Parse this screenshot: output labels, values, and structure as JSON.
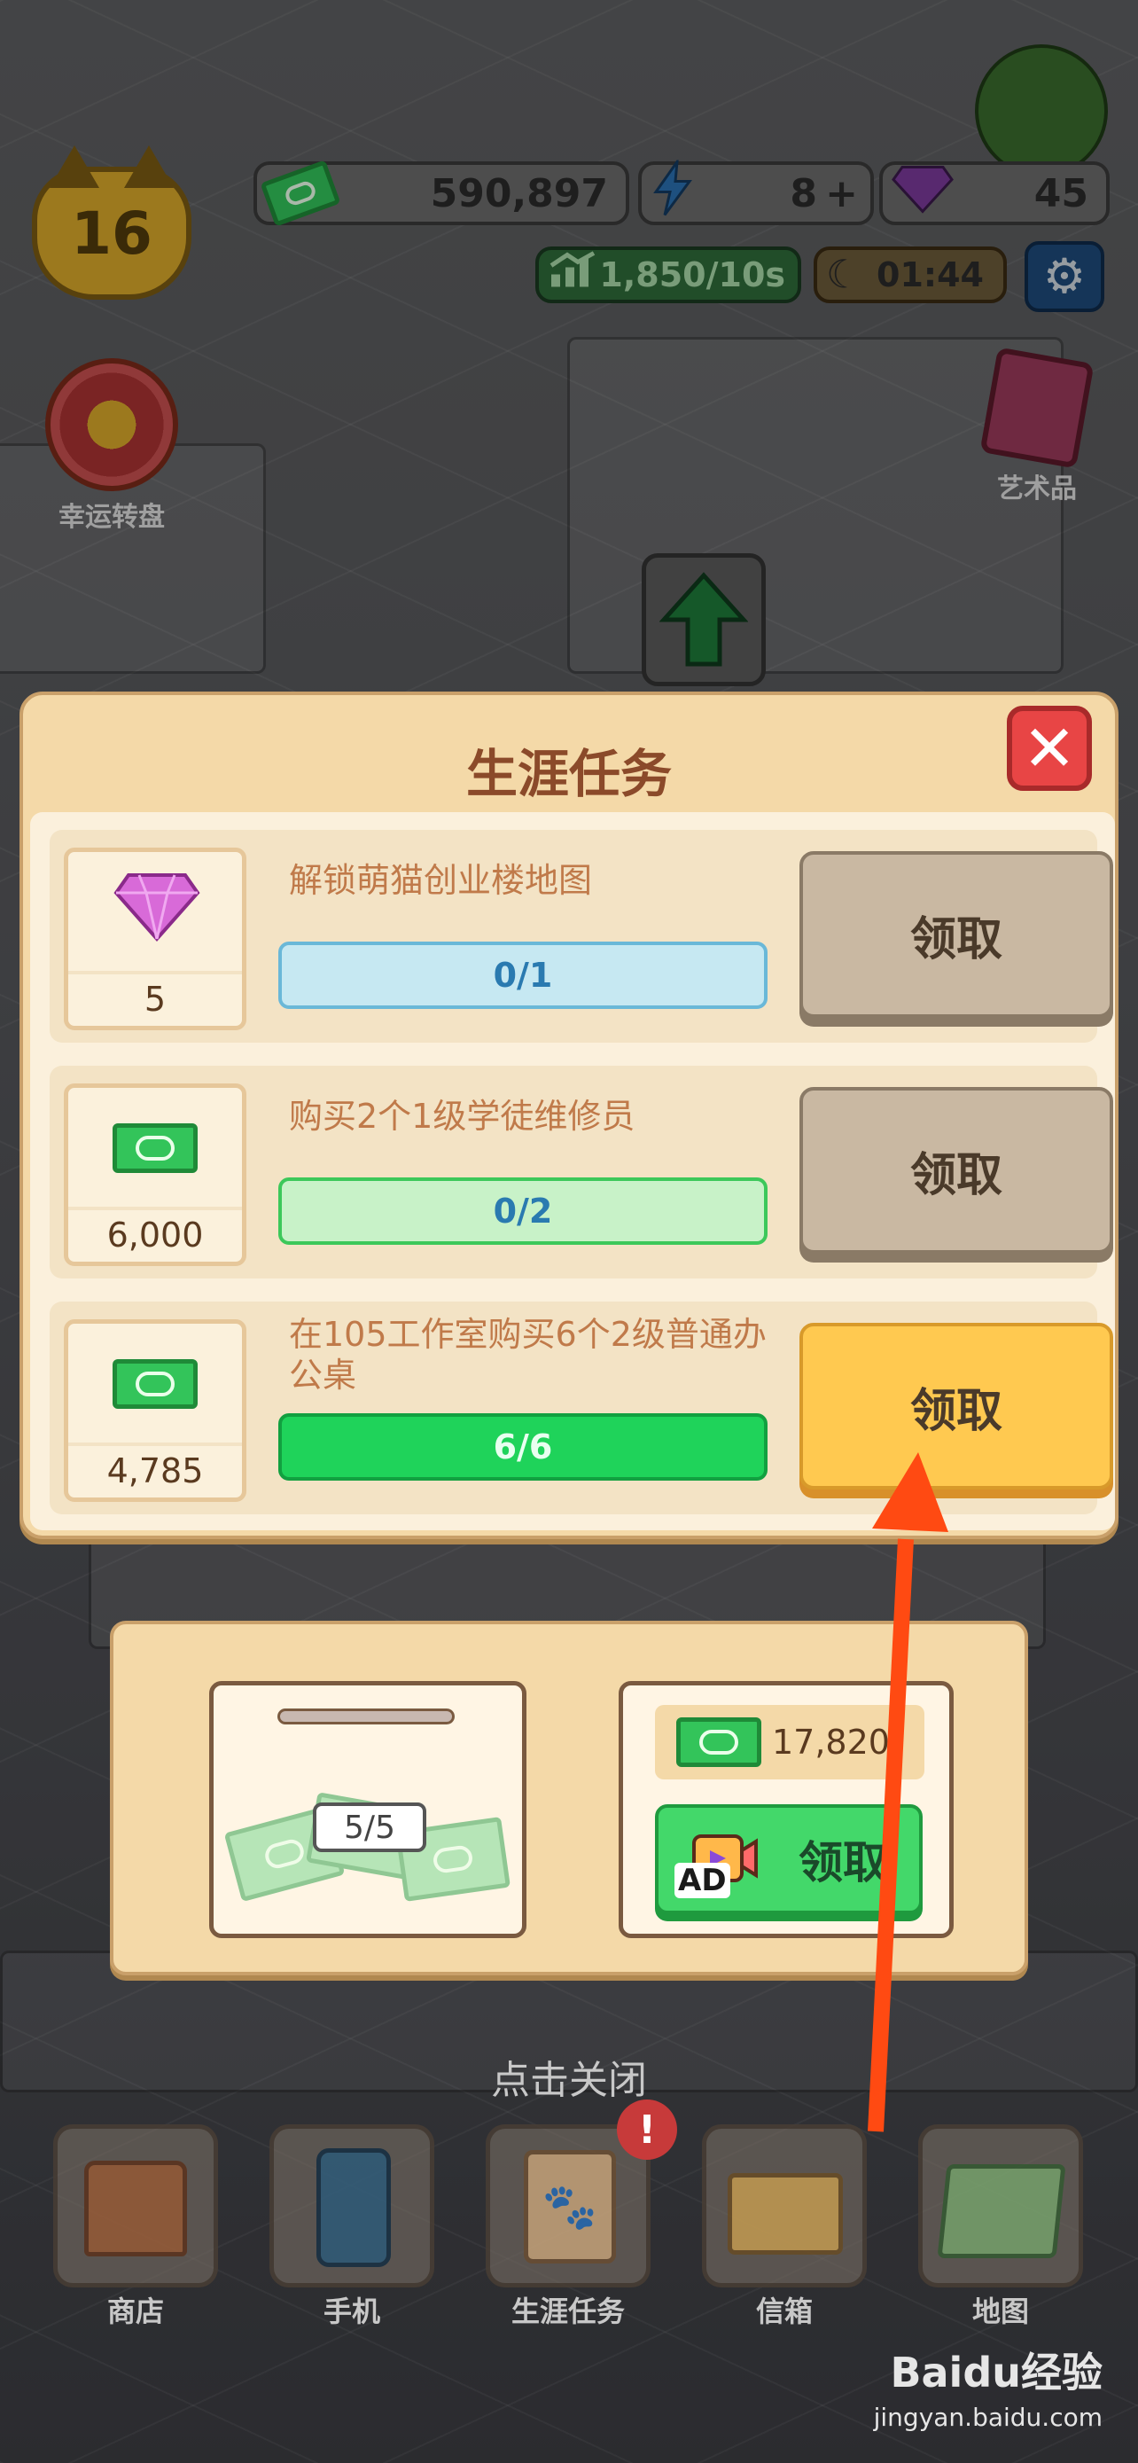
{
  "hud": {
    "level": "16",
    "cash": "590,897",
    "energy": "8",
    "energy_plus": "+",
    "gems": "45",
    "income_rate": "1,850/10s",
    "timer": "01:44"
  },
  "side": {
    "wheel_label": "幸运转盘",
    "art_label": "艺术品"
  },
  "modal": {
    "title": "生涯任务",
    "close": "✕",
    "tasks": [
      {
        "reward": "5",
        "reward_icon": "gem-icon",
        "text": "解锁萌猫创业楼地图",
        "progress": "0/1",
        "button": "领取",
        "state": "locked",
        "progress_fraction": 0.0
      },
      {
        "reward": "6,000",
        "reward_icon": "cash-icon",
        "text": "购买2个1级学徒维修员",
        "progress": "0/2",
        "button": "领取",
        "state": "locked",
        "progress_fraction": 0.0
      },
      {
        "reward": "4,785",
        "reward_icon": "cash-icon",
        "text": "在105工作室购买6个2级普通办公桌",
        "progress": "6/6",
        "button": "领取",
        "state": "ready",
        "progress_fraction": 1.0
      }
    ]
  },
  "bank": {
    "box_count": "5/5",
    "ad_amount": "17,820",
    "ad_badge": "AD",
    "ad_button": "领取"
  },
  "close_hint": "点击关闭",
  "nav": [
    {
      "label": "商店",
      "icon": "shop-icon"
    },
    {
      "label": "手机",
      "icon": "phone-icon"
    },
    {
      "label": "生涯任务",
      "icon": "career-tasks-icon"
    },
    {
      "label": "信箱",
      "icon": "mailbox-icon"
    },
    {
      "label": "地图",
      "icon": "map-icon"
    }
  ],
  "nav_badge": "!",
  "watermark": {
    "brand": "Baidu经验",
    "url": "jingyan.baidu.com"
  },
  "colors": {
    "ready_button": "#ffc950",
    "locked_button": "#c9b8a2",
    "complete_bar": "#1fd35a",
    "annotation_arrow": "#ff4a12"
  }
}
